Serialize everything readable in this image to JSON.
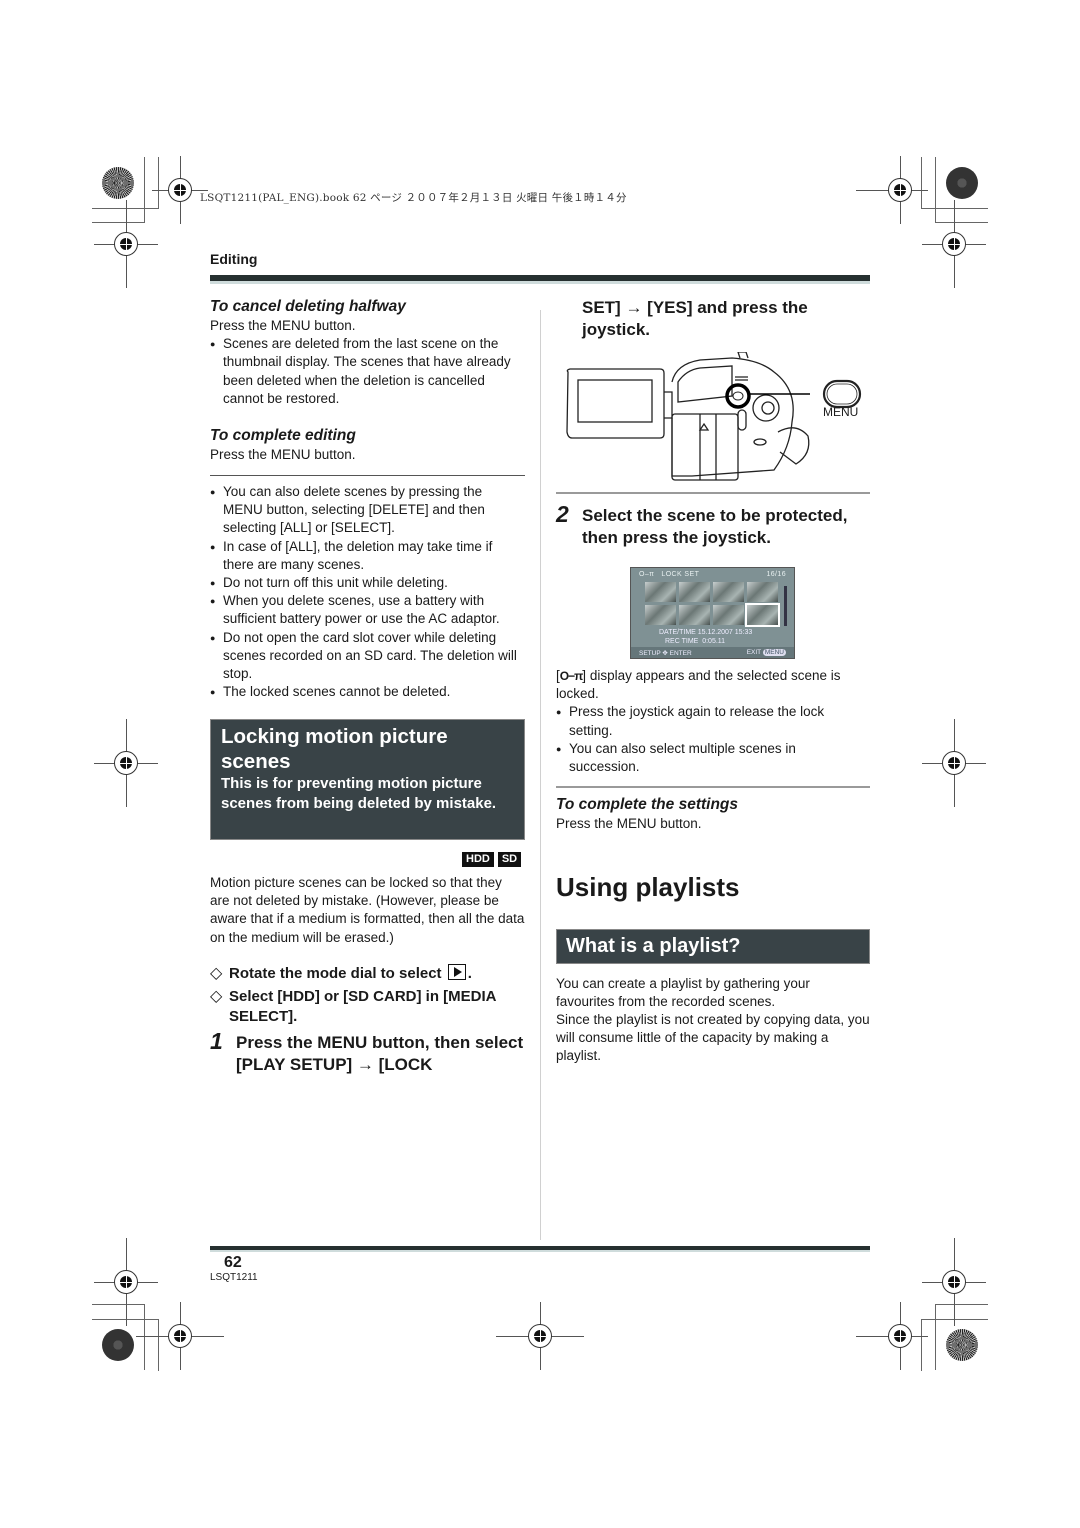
{
  "print_header": "LSQT1211(PAL_ENG).book  62 ページ  ２００７年２月１３日  火曜日  午後１時１４分",
  "section": "Editing",
  "left": {
    "cancel_heading": "To cancel deleting halfway",
    "cancel_text": "Press the MENU button.",
    "cancel_bullets": [
      "Scenes are deleted from the last scene on the thumbnail display. The scenes that have already been deleted when the deletion is cancelled cannot be restored."
    ],
    "complete_heading": "To complete editing",
    "complete_text": "Press the MENU button.",
    "notes": [
      "You can also delete scenes by pressing the MENU button, selecting [DELETE] and then selecting [ALL] or [SELECT].",
      "In case of [ALL], the deletion may take time if there are many scenes.",
      "Do not turn off this unit while deleting.",
      "When you delete scenes, use a battery with sufficient battery power or use the AC adaptor.",
      "Do not open the card slot cover while deleting scenes recorded on an SD card. The deletion will stop.",
      "The locked scenes cannot be deleted."
    ],
    "lock_box": {
      "title": "Locking motion picture scenes",
      "subtitle": "This is for preventing motion picture scenes from being deleted by mistake."
    },
    "media_badges": [
      "HDD",
      "SD"
    ],
    "intro": "Motion picture scenes can be locked so that they are not deleted by mistake. (However, please be aware that if a medium is formatted, then all the data on the medium will be erased.)",
    "pre_steps": [
      {
        "symbol": "◇",
        "text": "Rotate the mode dial to select",
        "suffix": "."
      },
      {
        "symbol": "◇",
        "text": "Select [HDD] or [SD CARD] in [MEDIA SELECT]."
      }
    ],
    "step1": {
      "number": "1",
      "text": "Press the MENU button, then select [PLAY SETUP] → [LOCK"
    }
  },
  "right": {
    "step1_cont": "SET] → [YES] and press the joystick.",
    "menu_label": "MENU",
    "step2": {
      "number": "2",
      "text": "Select the scene to be protected, then press the joystick."
    },
    "lcd": {
      "lock_icon": "O‒π",
      "title": "LOCK SET",
      "counter": "16/16",
      "date_label": "DATE/TIME",
      "date_value": "15.12.2007  15:33",
      "rec_label": "REC TIME",
      "rec_value": "0:05.11",
      "setup": "SETUP",
      "enter": "ENTER",
      "exit": "EXIT",
      "menu_pill": "MENU"
    },
    "lock_result": "display appears and the selected scene is locked.",
    "lock_bullets": [
      "Press the joystick again to release the lock setting.",
      "You can also select multiple scenes in succession."
    ],
    "complete_settings_heading": "To complete the settings",
    "complete_settings_text": "Press the MENU button.",
    "playlists_title": "Using playlists",
    "playlist_box_title": "What is a playlist?",
    "playlist_text_1": "You can create a playlist by gathering your favourites from the recorded scenes.",
    "playlist_text_2": "Since the playlist is not created by copying data, you will consume little of the capacity by making a playlist."
  },
  "footer": {
    "page_number": "62",
    "doc_code": "LSQT1211"
  }
}
